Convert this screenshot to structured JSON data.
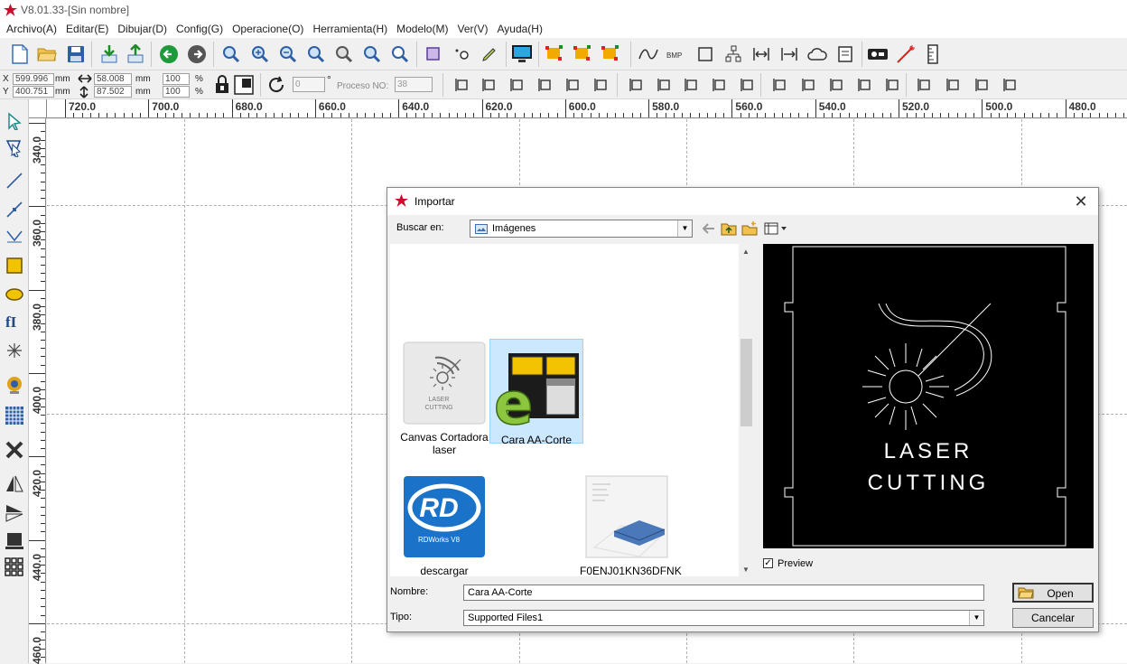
{
  "app": {
    "title": "V8.01.33-[Sin nombre]"
  },
  "menu": [
    "Archivo(A)",
    "Editar(E)",
    "Dibujar(D)",
    "Config(G)",
    "Operacione(O)",
    "Herramienta(H)",
    "Modelo(M)",
    "Ver(V)",
    "Ayuda(H)"
  ],
  "coords": {
    "x_label": "X",
    "x_value": "599.996",
    "x_unit": "mm",
    "y_label": "Y",
    "y_value": "400.751",
    "y_unit": "mm",
    "width_value": "58.008",
    "width_unit": "mm",
    "height_value": "87.502",
    "height_unit": "mm",
    "scale_x": "100",
    "scale_y": "100",
    "percent": "%",
    "angle_value": "0",
    "degree": "°",
    "proceso_label": "Proceso NO:",
    "proceso_value": "38"
  },
  "ruler": {
    "h_labels": [
      "720.0",
      "700.0",
      "680.0",
      "660.0",
      "640.0",
      "620.0",
      "600.0",
      "580.0",
      "560.0",
      "540.0",
      "520.0",
      "500.0",
      "480.0"
    ],
    "v_labels": [
      "340.0",
      "360.0",
      "380.0",
      "400.0",
      "420.0",
      "440.0",
      "460.0"
    ]
  },
  "dialog": {
    "title": "Importar",
    "close_glyph": "✕",
    "buscar_label": "Buscar en:",
    "buscar_value": "Imágenes",
    "files": [
      {
        "name": "Canvas Cortadora laser",
        "thumb_text": "LASER\nCUTTING"
      },
      {
        "name": "Cara AA-Corte",
        "selected": true
      },
      {
        "name": "descargar",
        "thumb_text": "RDWorks V8",
        "logo": "RD"
      },
      {
        "name": "F0ENJ01KN36DFNK"
      }
    ],
    "preview_text_1": "LASER",
    "preview_text_2": "CUTTING",
    "preview_label": "Preview",
    "nombre_label": "Nombre:",
    "nombre_value": "Cara AA-Corte",
    "tipo_label": "Tipo:",
    "tipo_value": "Supported Files1",
    "open_label": "Open",
    "cancel_label": "Cancelar"
  },
  "colors": {
    "accent_red": "#c8102e",
    "selection": "#cce8ff",
    "preview_bg": "#000000"
  }
}
